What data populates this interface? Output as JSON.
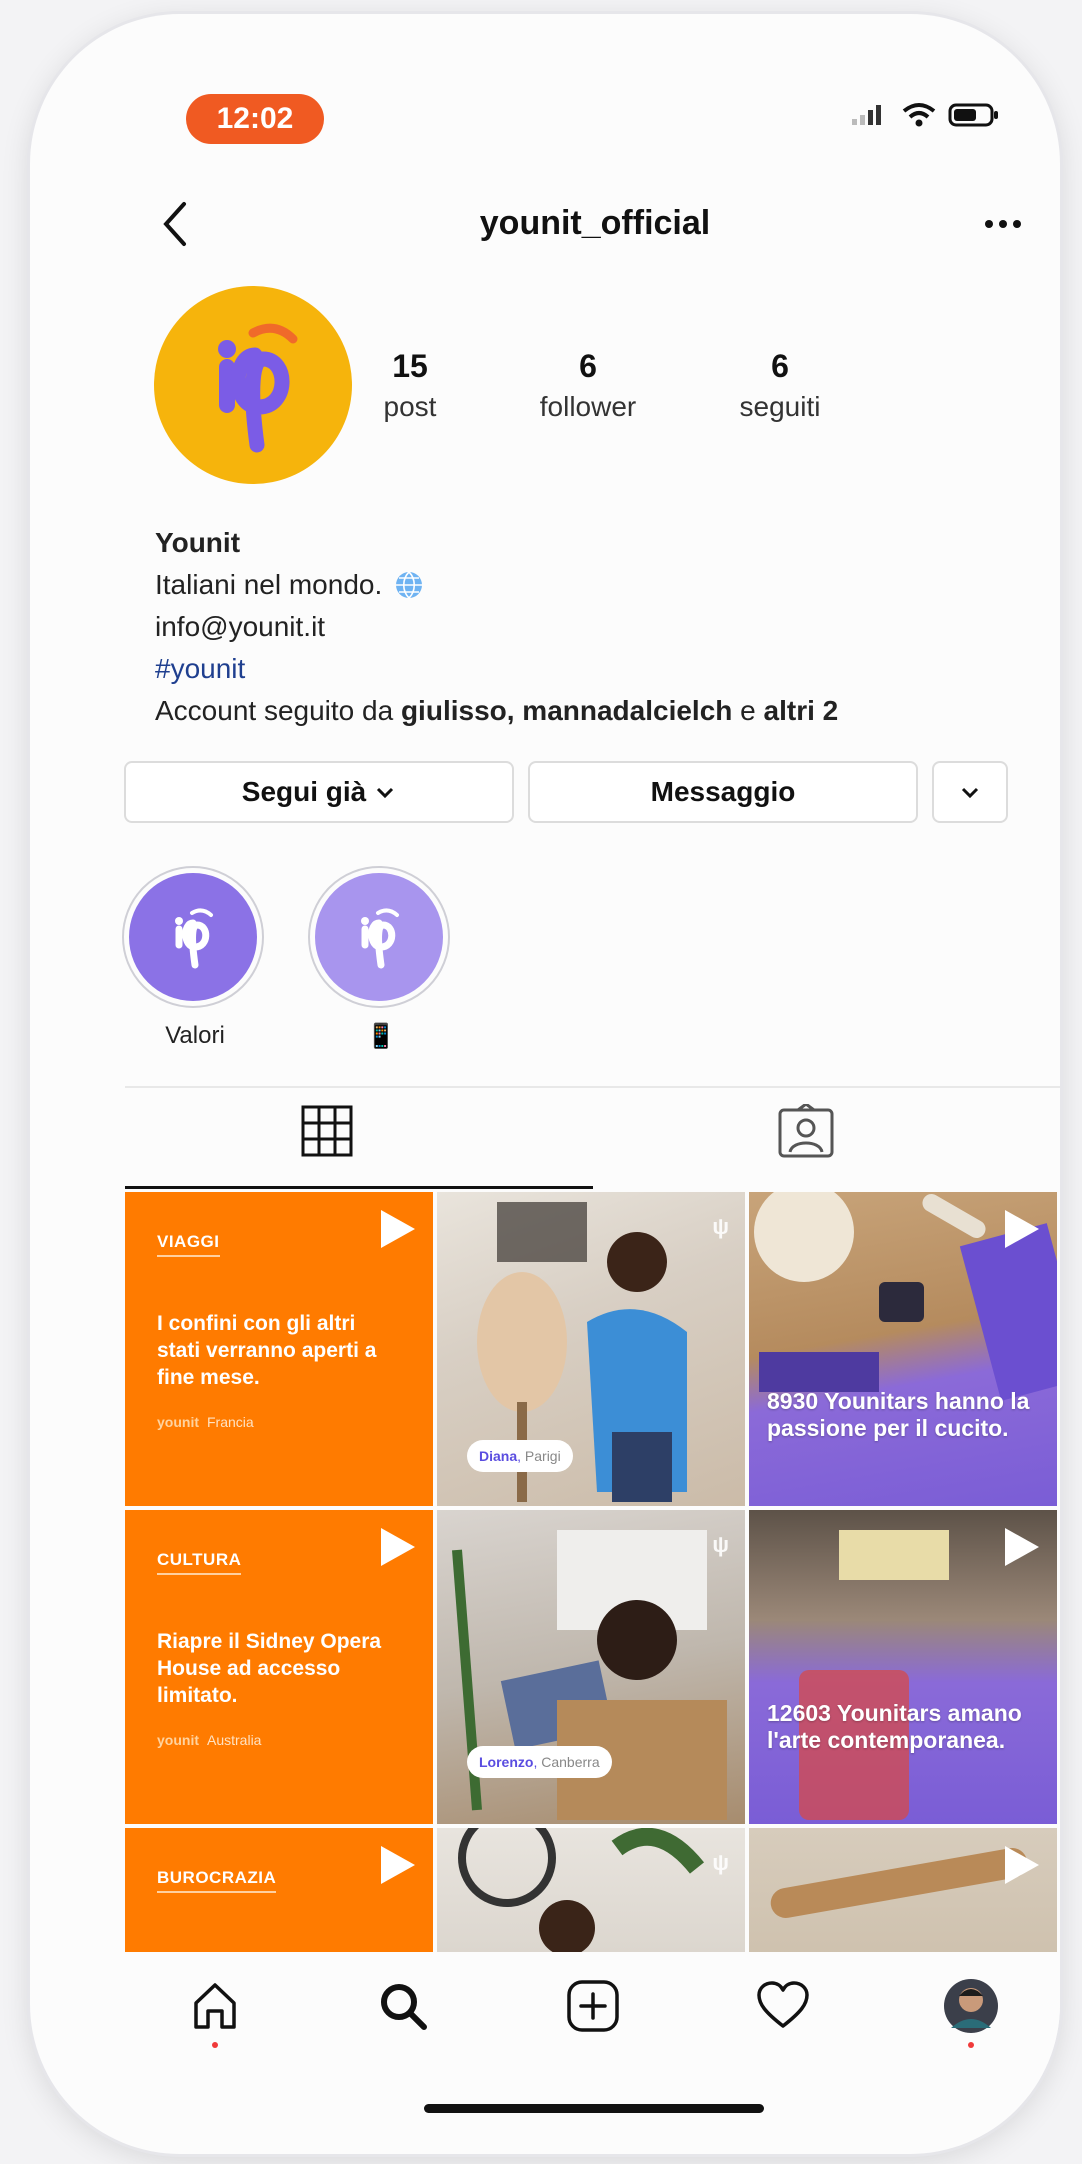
{
  "status_bar": {
    "time": "12:02"
  },
  "header": {
    "username": "younit_official"
  },
  "profile": {
    "stats": [
      {
        "value": "15",
        "label": "post"
      },
      {
        "value": "6",
        "label": "follower"
      },
      {
        "value": "6",
        "label": "seguiti"
      }
    ],
    "name": "Younit",
    "bio_line": "Italiani nel mondo.",
    "email": "info@younit.it",
    "hashtag": "#younit",
    "followed_by_prefix": "Account seguito da ",
    "followed_by_names": "giulisso, mannadalcielch",
    "followed_by_mid": " e ",
    "followed_by_others": "altri 2"
  },
  "actions": {
    "follow_label": "Segui già",
    "message_label": "Messaggio"
  },
  "highlights": [
    {
      "label": "Valori",
      "color": "#8b72e6"
    },
    {
      "label": "📱",
      "color": "#a895ee"
    }
  ],
  "posts": [
    {
      "category": "VIAGGI",
      "text": "I confini con gli altri stati verranno aperti a fine mese.",
      "brand": "younit",
      "place": "Francia"
    },
    {
      "chip_name": "Diana",
      "chip_place": "Parigi"
    },
    {
      "text": "8930 Younitars hanno la passione per il cucito."
    },
    {
      "category": "CULTURA",
      "text": "Riapre il Sidney Opera House ad accesso limitato.",
      "brand": "younit",
      "place": "Australia"
    },
    {
      "chip_name": "Lorenzo",
      "chip_place": "Canberra"
    },
    {
      "text": "12603 Younitars amano l'arte contemporanea."
    },
    {
      "category": "BUROCRAZIA"
    }
  ],
  "colors": {
    "accent": "#ff7b00",
    "brand_purple": "#7b5ce6",
    "status_pill": "#f05a22"
  }
}
